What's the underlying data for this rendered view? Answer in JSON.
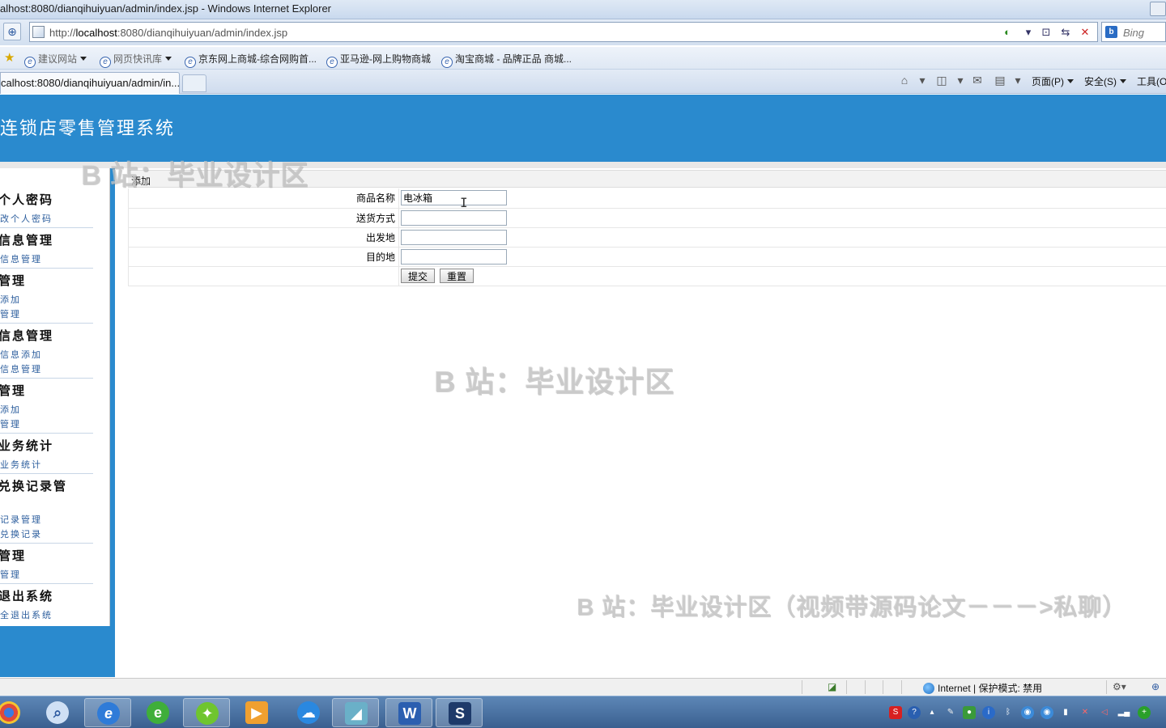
{
  "window": {
    "title": "alhost:8080/dianqihuiyuan/admin/index.jsp - Windows Internet Explorer"
  },
  "address": {
    "url_prefix": "http://",
    "url_host": "localhost",
    "url_rest": ":8080/dianqihuiyuan/admin/index.jsp",
    "search_placeholder": "Bing"
  },
  "favorites": {
    "items": [
      {
        "label": "建议网站",
        "dropdown": true
      },
      {
        "label": "网页快讯库",
        "dropdown": true
      },
      {
        "label": "京东网上商城-综合网购首..."
      },
      {
        "label": "亚马逊-网上购物商城"
      },
      {
        "label": "淘宝商城 - 品牌正品 商城..."
      }
    ]
  },
  "tabs": {
    "active_title": "calhost:8080/dianqihuiyuan/admin/in..."
  },
  "commandbar": {
    "page_menu": "页面(P)",
    "safety_menu": "安全(S)",
    "tools_menu": "工具(O"
  },
  "app": {
    "title": "连锁店零售管理系统"
  },
  "sidebar": {
    "sections": [
      {
        "title": "个人密码",
        "links": [
          "改个人密码"
        ]
      },
      {
        "title": "信息管理",
        "links": [
          "信息管理"
        ]
      },
      {
        "title": "管理",
        "links": [
          "添加",
          "管理"
        ]
      },
      {
        "title": "信息管理",
        "links": [
          "信息添加",
          "信息管理"
        ]
      },
      {
        "title": "管理",
        "links": [
          "添加",
          "管理"
        ]
      },
      {
        "title": "业务统计",
        "links": [
          "业务统计"
        ]
      },
      {
        "title": "兑换记录管",
        "links": [
          "记录管理",
          "兑换记录"
        ]
      },
      {
        "title": "管理",
        "links": [
          "管理"
        ]
      },
      {
        "title": "退出系统",
        "links": [
          "全退出系统"
        ]
      }
    ]
  },
  "form": {
    "heading": "添加",
    "fields": [
      {
        "label": "商品名称",
        "value": ""
      },
      {
        "label": "送货方式",
        "value": ""
      },
      {
        "label": "出发地",
        "value": ""
      },
      {
        "label": "目的地",
        "value": ""
      }
    ],
    "product_name_value": "电冰箱",
    "submit_label": "提交",
    "reset_label": "重置"
  },
  "watermarks": {
    "small": "B 站：毕业设计区",
    "center": "B 站：毕业设计区",
    "bottom": "B 站：毕业设计区（视频带源码论文－－－>私聊）"
  },
  "statusbar": {
    "zone": "Internet | 保护模式: 禁用"
  },
  "colors": {
    "header_blue": "#2a8ace",
    "link_blue": "#2b5d9d"
  }
}
